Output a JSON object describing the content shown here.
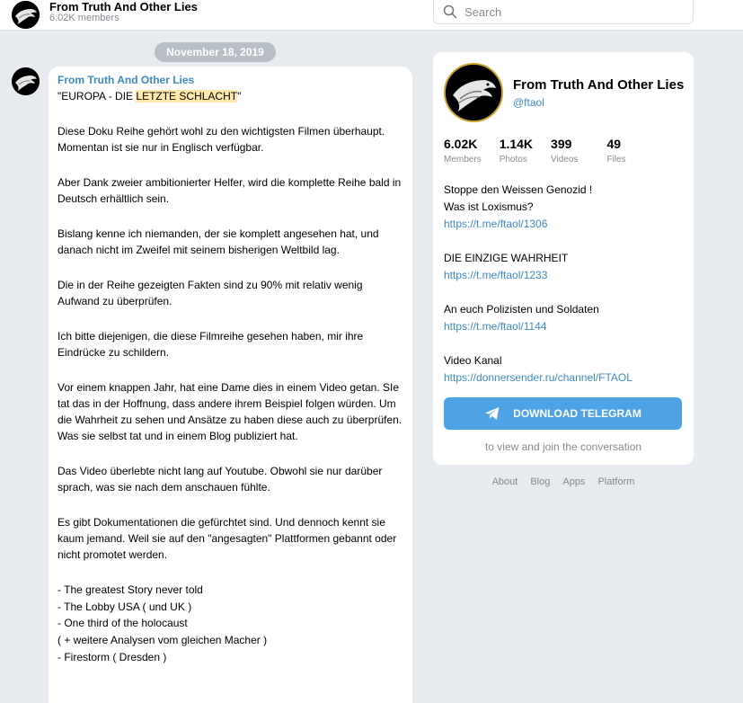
{
  "header": {
    "channel_name": "From Truth And Other Lies",
    "members": "6.02K members",
    "search_placeholder": "Search"
  },
  "feed": {
    "date": "November 18, 2019",
    "message": {
      "author": "From Truth And Other Lies",
      "title_prefix": "\"EUROPA - DIE ",
      "title_highlight": "LETZTE SCHLACHT",
      "title_suffix": "\"",
      "paragraphs": [
        "Diese Doku Reihe gehört wohl zu den wichtigsten Filmen überhaupt. Momentan ist sie nur in Englisch verfügbar.",
        "Aber Dank zweier ambitionierter Helfer, wird die komplette Reihe bald in Deutsch erhältlich sein.",
        "Bislang kenne ich niemanden, der sie komplett angesehen hat, und danach nicht im Zweifel mit seinem bisherigen Weltbild lag.",
        "Die in der Reihe gezeigten Fakten sind zu 90% mit relativ wenig Aufwand zu überprüfen.",
        "Ich bitte diejenigen, die diese Filmreihe gesehen haben, mir ihre Eindrücke zu schildern.",
        "Vor einem knappen Jahr, hat eine Dame dies in einem Video getan. SIe tat das in der Hoffnung, dass andere ihrem Beispiel folgen würden. Um die Wahrheit zu sehen und Ansätze zu haben diese auch zu überprüfen. Was sie selbst tat und in einem Blog publiziert hat.",
        "Das Video überlebte nicht lang auf Youtube. Obwohl sie nur darüber sprach, was sie nach dem anschauen fühlte.",
        "Es gibt Dokumentationen die gefürchtet sind. Und dennoch kennt sie kaum jemand. Weil sie auf den \"angesagten\" Plattformen gebannt oder nicht promotet werden."
      ],
      "list": [
        "- The greatest Story never told",
        "- The Lobby USA ( und UK )",
        "- One third of the holocaust",
        "( + weitere Analysen vom gleichen Macher )",
        "- Firestorm ( Dresden )"
      ]
    }
  },
  "card": {
    "title": "From Truth And Other Lies",
    "handle": "@ftaol",
    "stats": [
      {
        "value": "6.02K",
        "label": "Members"
      },
      {
        "value": "1.14K",
        "label": "Photos"
      },
      {
        "value": "399",
        "label": "Videos"
      },
      {
        "value": "49",
        "label": "Files"
      }
    ],
    "description": {
      "line1": "Stoppe den Weissen Genozid !",
      "line2": "Was ist Loxismus?",
      "link1": "https://t.me/ftaol/1306",
      "line3": "DIE EINZIGE WAHRHEIT",
      "link2": "https://t.me/ftaol/1233",
      "line4": "An euch Polizisten und Soldaten",
      "link3": "https://t.me/ftaol/1144",
      "line5": "Video Kanal",
      "link4": "https://donnersender.ru/channel/FTAOL"
    },
    "download_button": "DOWNLOAD TELEGRAM",
    "hint": "to view and join the conversation"
  },
  "footer": {
    "links": [
      "About",
      "Blog",
      "Apps",
      "Platform"
    ]
  },
  "colors": {
    "accent": "#3d8ac4",
    "button": "#4da3e6",
    "background": "#e7ebf0",
    "highlight": "#ffe9a8"
  }
}
